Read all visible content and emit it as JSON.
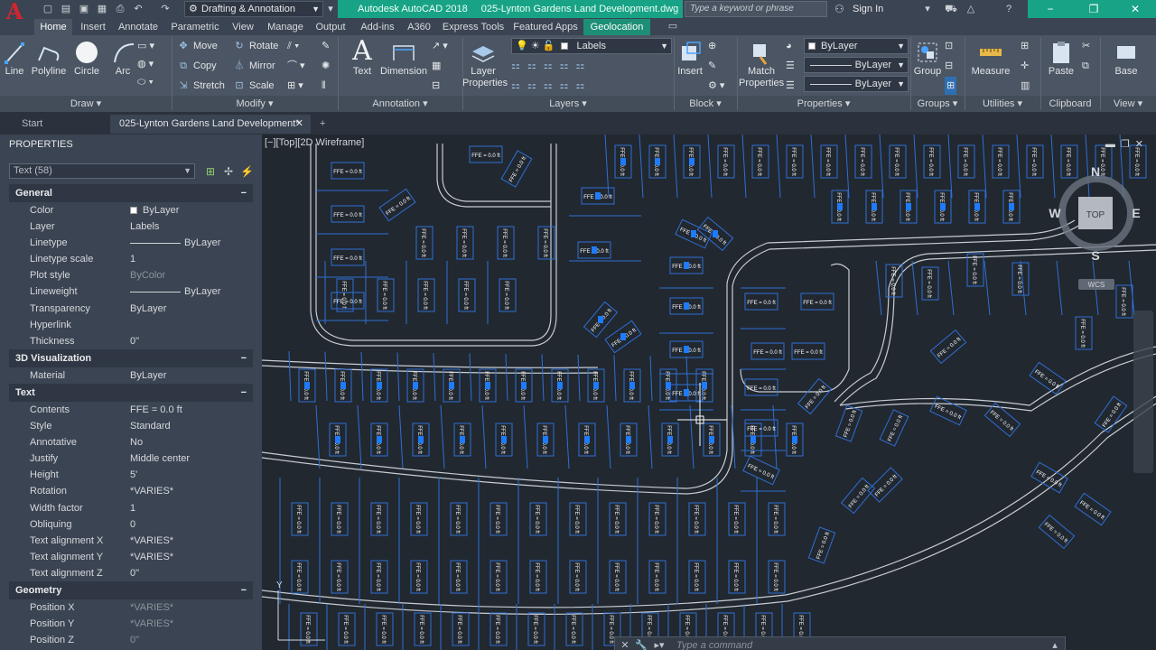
{
  "app_letter": "A",
  "title_bar": {
    "workspace": "Drafting & Annotation",
    "app_name": "Autodesk AutoCAD 2018",
    "file_name": "025-Lynton Gardens Land Development.dwg",
    "search_placeholder": "Type a keyword or phrase",
    "sign_in": "Sign In"
  },
  "menu_tabs": [
    "Home",
    "Insert",
    "Annotate",
    "Parametric",
    "View",
    "Manage",
    "Output",
    "Add-ins",
    "A360",
    "Express Tools",
    "Featured Apps",
    "Geolocation"
  ],
  "ribbon": {
    "draw": {
      "line": "Line",
      "polyline": "Polyline",
      "circle": "Circle",
      "arc": "Arc"
    },
    "modify": {
      "move": "Move",
      "rotate": "Rotate",
      "copy": "Copy",
      "mirror": "Mirror",
      "stretch": "Stretch",
      "scale": "Scale"
    },
    "annotation": {
      "text": "Text",
      "dimension": "Dimension"
    },
    "layers": {
      "layer_properties": [
        "Layer",
        "Properties"
      ],
      "current_layer": "Labels"
    },
    "block": {
      "insert": "Insert"
    },
    "properties": {
      "match_properties": [
        "Match",
        "Properties"
      ],
      "color": "ByLayer",
      "linetype": "ByLayer",
      "lineweight": "ByLayer"
    },
    "groups": {
      "group": "Group"
    },
    "utilities": {
      "measure": "Measure"
    },
    "clipboard": {
      "paste": "Paste"
    },
    "view": {
      "base": "Base"
    },
    "panel_labels": [
      "Draw",
      "Modify",
      "Annotation",
      "Layers",
      "Block",
      "Properties",
      "Groups",
      "Utilities",
      "Clipboard",
      "View"
    ]
  },
  "doc_tabs": [
    "Start",
    "025-Lynton Gardens Land Development*"
  ],
  "properties": {
    "header": "PROPERTIES",
    "selection": "Text (58)",
    "sections": [
      {
        "title": "General",
        "rows": [
          [
            "Color",
            "ByLayer"
          ],
          [
            "Layer",
            "Labels"
          ],
          [
            "Linetype",
            "ByLayer"
          ],
          [
            "Linetype scale",
            "1"
          ],
          [
            "Plot style",
            "ByColor"
          ],
          [
            "Lineweight",
            "ByLayer"
          ],
          [
            "Transparency",
            "ByLayer"
          ],
          [
            "Hyperlink",
            ""
          ],
          [
            "Thickness",
            "0\""
          ]
        ]
      },
      {
        "title": "3D Visualization",
        "rows": [
          [
            "Material",
            "ByLayer"
          ]
        ]
      },
      {
        "title": "Text",
        "rows": [
          [
            "Contents",
            "FFE = 0.0 ft"
          ],
          [
            "Style",
            "Standard"
          ],
          [
            "Annotative",
            "No"
          ],
          [
            "Justify",
            "Middle center"
          ],
          [
            "Height",
            "5'"
          ],
          [
            "Rotation",
            "*VARIES*"
          ],
          [
            "Width factor",
            "1"
          ],
          [
            "Obliquing",
            "0"
          ],
          [
            "Text alignment X",
            "*VARIES*"
          ],
          [
            "Text alignment Y",
            "*VARIES*"
          ],
          [
            "Text alignment Z",
            "0\""
          ]
        ]
      },
      {
        "title": "Geometry",
        "rows": [
          [
            "Position X",
            "*VARIES*"
          ],
          [
            "Position Y",
            "*VARIES*"
          ],
          [
            "Position Z",
            "0\""
          ]
        ]
      }
    ]
  },
  "drawing": {
    "viewport_label": "[−][Top][2D Wireframe]",
    "viewcube": {
      "top": "TOP",
      "n": "N",
      "s": "S",
      "e": "E",
      "w": "W",
      "wcs": "WCS"
    },
    "lot_label": "FFE = 0.0 ft",
    "command_placeholder": "Type a command"
  },
  "colors": {
    "accent_green": "#18a386",
    "lot_lines": "#2f6fd6",
    "grips": "#1e7bff",
    "canvas": "#212830"
  }
}
